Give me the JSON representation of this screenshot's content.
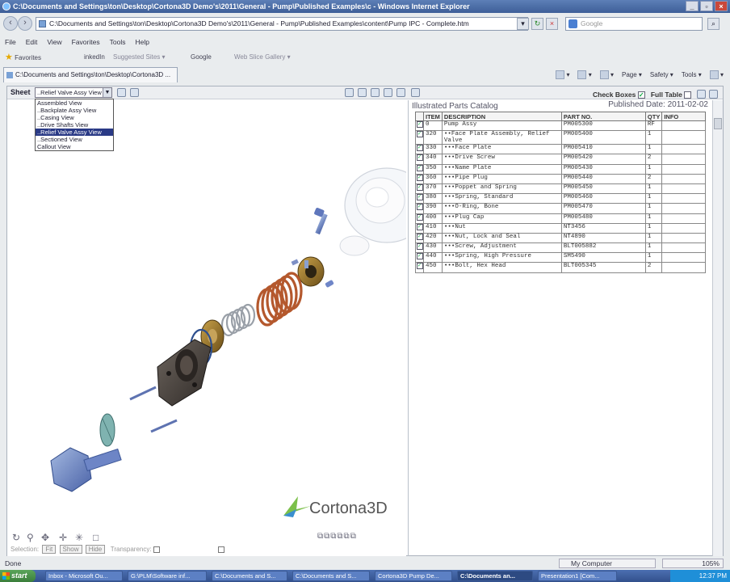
{
  "window": {
    "title": "C:\\Documents and Settings\\ton\\Desktop\\Cortona3D Demo's\\2011\\General - Pump\\Published Examples\\c - Windows Internet Explorer"
  },
  "address": {
    "url": "C:\\Documents and Settings\\ton\\Desktop\\Cortona3D Demo's\\2011\\General - Pump\\Published Examples\\content\\Pump IPC - Complete.htm"
  },
  "search": {
    "placeholder": "Google"
  },
  "menu": [
    "File",
    "Edit",
    "View",
    "Favorites",
    "Tools",
    "Help"
  ],
  "favorites": {
    "label": "Favorites",
    "linkedin": "inkedIn",
    "suggested": "Suggested Sites ▾",
    "google": "Google",
    "webslice": "Web Slice Gallery ▾"
  },
  "tab": {
    "title": "C:\\Documents and Settings\\ton\\Desktop\\Cortona3D ..."
  },
  "command_bar": {
    "page": "Page ▾",
    "safety": "Safety ▾",
    "tools": "Tools ▾"
  },
  "viewer": {
    "sheet_label": "Sheet",
    "sheet_selected": "..Relief Valve Assy View",
    "sheet_options": [
      "Assembled View",
      "..Backplate Assy View",
      "..Casing View",
      "..Drive Shafts View",
      "..Relief Valve Assy View",
      "..Sectioned View",
      "Callout View"
    ],
    "sheet_selected_index": 4,
    "check_boxes_label": "Check Boxes",
    "full_table_label": "Full Table",
    "logo_text": "Cortona3D",
    "selection_label": "Selection:",
    "fit_btn": "Fit",
    "show_btn": "Show",
    "hide_btn": "Hide",
    "transparency_label": "Transparency:"
  },
  "ipc": {
    "title": "Illustrated Parts Catalog",
    "published": "Published Date: 2011-02-02",
    "columns": [
      "ITEM",
      "DESCRIPTION",
      "PART NO.",
      "QTY",
      "INFO"
    ],
    "rows": [
      {
        "item": "0",
        "desc": "Pump Assy",
        "part": "PM005300",
        "qty": "RF",
        "checked": true
      },
      {
        "item": "320",
        "desc": "••Face Plate Assembly, Relief Valve",
        "part": "PM005400",
        "qty": "1",
        "checked": true
      },
      {
        "item": "330",
        "desc": "•••Face Plate",
        "part": "PM005410",
        "qty": "1",
        "checked": true
      },
      {
        "item": "340",
        "desc": "•••Drive Screw",
        "part": "PM005420",
        "qty": "2",
        "checked": true
      },
      {
        "item": "350",
        "desc": "•••Name Plate",
        "part": "PM005430",
        "qty": "1",
        "checked": true
      },
      {
        "item": "360",
        "desc": "•••Pipe Plug",
        "part": "PM005440",
        "qty": "2",
        "checked": true
      },
      {
        "item": "370",
        "desc": "•••Poppet and Spring",
        "part": "PM005450",
        "qty": "1",
        "checked": true
      },
      {
        "item": "380",
        "desc": "•••Spring, Standard",
        "part": "PM005460",
        "qty": "1",
        "checked": true
      },
      {
        "item": "390",
        "desc": "•••O-Ring, Bone",
        "part": "PM005470",
        "qty": "1",
        "checked": true
      },
      {
        "item": "400",
        "desc": "•••Plug Cap",
        "part": "PM005480",
        "qty": "1",
        "checked": true
      },
      {
        "item": "410",
        "desc": "•••Nut",
        "part": "NT3456",
        "qty": "1",
        "checked": true
      },
      {
        "item": "420",
        "desc": "•••Nut, Lock and Seal",
        "part": "NT4890",
        "qty": "1",
        "checked": true
      },
      {
        "item": "430",
        "desc": "•••Screw, Adjustment",
        "part": "BLT005882",
        "qty": "1",
        "checked": true
      },
      {
        "item": "440",
        "desc": "•••Spring, High Pressure",
        "part": "SM5490",
        "qty": "1",
        "checked": true
      },
      {
        "item": "450",
        "desc": "•••Bolt, Hex Head",
        "part": "BLT005345",
        "qty": "2",
        "checked": true
      }
    ]
  },
  "status": {
    "left": "Done",
    "zone": "My Computer",
    "zoom": "105%"
  },
  "taskbar": {
    "start": "start",
    "buttons": [
      "Inbox - Microsoft Ou...",
      "G:\\PLM\\Software inf...",
      "C:\\Documents and S...",
      "C:\\Documents and S...",
      "Cortona3D Pump De...",
      "C:\\Documents an...",
      "Presentation1 [Com..."
    ],
    "active_index": 5,
    "clock": "12:37 PM"
  },
  "colors": {
    "title_bar": "#3e5f98",
    "taskbar": "#32508c",
    "selection": "#2a3a86",
    "spring": "#b4582d",
    "housing": "#4a4440"
  }
}
